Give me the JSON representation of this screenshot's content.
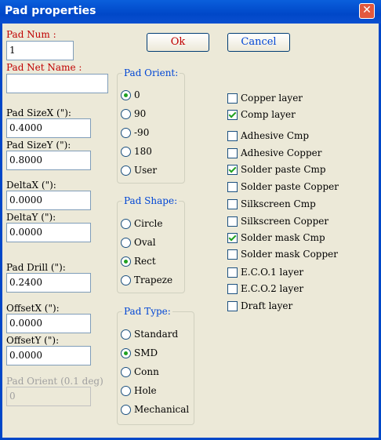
{
  "window": {
    "title": "Pad properties",
    "close_glyph": "✕"
  },
  "buttons": {
    "ok": "Ok",
    "cancel": "Cancel"
  },
  "fields": {
    "pad_num": {
      "label": "Pad Num :",
      "value": "1"
    },
    "pad_net_name": {
      "label": "Pad Net Name :",
      "value": ""
    },
    "pad_size_x": {
      "label": "Pad SizeX (\"):",
      "value": "0.4000"
    },
    "pad_size_y": {
      "label": "Pad SizeY (\"):",
      "value": "0.8000"
    },
    "delta_x": {
      "label": "DeltaX (\"):",
      "value": "0.0000"
    },
    "delta_y": {
      "label": "DeltaY (\"):",
      "value": "0.0000"
    },
    "pad_drill": {
      "label": "Pad Drill (\"):",
      "value": "0.2400"
    },
    "offset_x": {
      "label": "OffsetX (\"):",
      "value": "0.0000"
    },
    "offset_y": {
      "label": "OffsetY (\"):",
      "value": "0.0000"
    },
    "pad_orient_deg": {
      "label": "Pad Orient (0.1 deg)",
      "value": "0"
    }
  },
  "pad_orient": {
    "title": "Pad Orient:",
    "options": [
      "0",
      "90",
      "-90",
      "180",
      "User"
    ],
    "selected": "0"
  },
  "pad_shape": {
    "title": "Pad Shape:",
    "options": [
      "Circle",
      "Oval",
      "Rect",
      "Trapeze"
    ],
    "selected": "Rect"
  },
  "pad_type": {
    "title": "Pad Type:",
    "options": [
      "Standard",
      "SMD",
      "Conn",
      "Hole",
      "Mechanical"
    ],
    "selected": "SMD"
  },
  "layers": [
    {
      "label": "Copper layer",
      "checked": false
    },
    {
      "label": "Comp layer",
      "checked": true
    },
    {
      "label": "Adhesive Cmp",
      "checked": false
    },
    {
      "label": "Adhesive Copper",
      "checked": false
    },
    {
      "label": "Solder paste Cmp",
      "checked": true
    },
    {
      "label": "Solder paste Copper",
      "checked": false
    },
    {
      "label": "Silkscreen Cmp",
      "checked": false
    },
    {
      "label": "Silkscreen Copper",
      "checked": false
    },
    {
      "label": "Solder mask Cmp",
      "checked": true
    },
    {
      "label": "Solder mask Copper",
      "checked": false
    },
    {
      "label": "E.C.O.1 layer",
      "checked": false
    },
    {
      "label": "E.C.O.2 layer",
      "checked": false
    },
    {
      "label": "Draft layer",
      "checked": false
    }
  ]
}
